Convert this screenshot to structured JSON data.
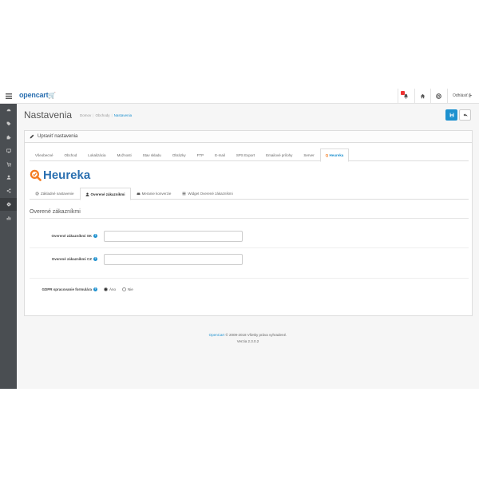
{
  "header": {
    "logo_text": "opencart",
    "logo_cart": "🛒",
    "notification_count": "5",
    "logout_label": "Odhlásiť"
  },
  "sidebar": {
    "items": [
      {
        "icon": "dashboard-icon"
      },
      {
        "icon": "tag-icon"
      },
      {
        "icon": "puzzle-icon"
      },
      {
        "icon": "desktop-icon"
      },
      {
        "icon": "shopping-cart-icon"
      },
      {
        "icon": "user-icon"
      },
      {
        "icon": "share-icon"
      },
      {
        "icon": "cog-icon"
      },
      {
        "icon": "bar-chart-icon"
      }
    ]
  },
  "page": {
    "title": "Nastavenia",
    "breadcrumb": [
      "Domov",
      "Obchody",
      "Nastavenia"
    ]
  },
  "panel": {
    "heading": "Upraviť nastavenia"
  },
  "tabs": [
    {
      "label": "Všeobecné"
    },
    {
      "label": "Obchod"
    },
    {
      "label": "Lokalizácia"
    },
    {
      "label": "Možnosti"
    },
    {
      "label": "Stav skladu"
    },
    {
      "label": "Obrázky"
    },
    {
      "label": "FTP"
    },
    {
      "label": "E-mail"
    },
    {
      "label": "SPS Export"
    },
    {
      "label": "Emailové prílohy"
    },
    {
      "label": "Server"
    },
    {
      "label": "Heureka",
      "active": true
    }
  ],
  "heureka": {
    "logo_text": "Heureka"
  },
  "subtabs": [
    {
      "label": "Základné nastavenie",
      "icon": "cog-icon"
    },
    {
      "label": "Overené zákazníkmi",
      "icon": "user-icon",
      "active": true
    },
    {
      "label": "Meranie konverzie",
      "icon": "car-icon"
    },
    {
      "label": "Widget Overené zákazníkmi",
      "icon": "list-icon"
    }
  ],
  "section": {
    "title": "Overené zákazníkmi"
  },
  "form": {
    "sk_label": "Overené zákazníkmi SK",
    "sk_value": "",
    "cz_label": "Overené zákazníkmi CZ",
    "cz_value": "",
    "gdpr_label": "GDPR spracovanie formulára",
    "gdpr_yes": "Áno",
    "gdpr_no": "Nie",
    "gdpr_selected": "Áno"
  },
  "footer": {
    "link": "OpenCart",
    "copyright": "© 2009-2018 Všetky práva vyhradené.",
    "version": "Verzia 2.3.0.2"
  },
  "colors": {
    "accent": "#1e91cf",
    "sidebar": "#4a4e52",
    "heureka_orange": "#f47b20",
    "heureka_blue": "#2a6fb0"
  }
}
